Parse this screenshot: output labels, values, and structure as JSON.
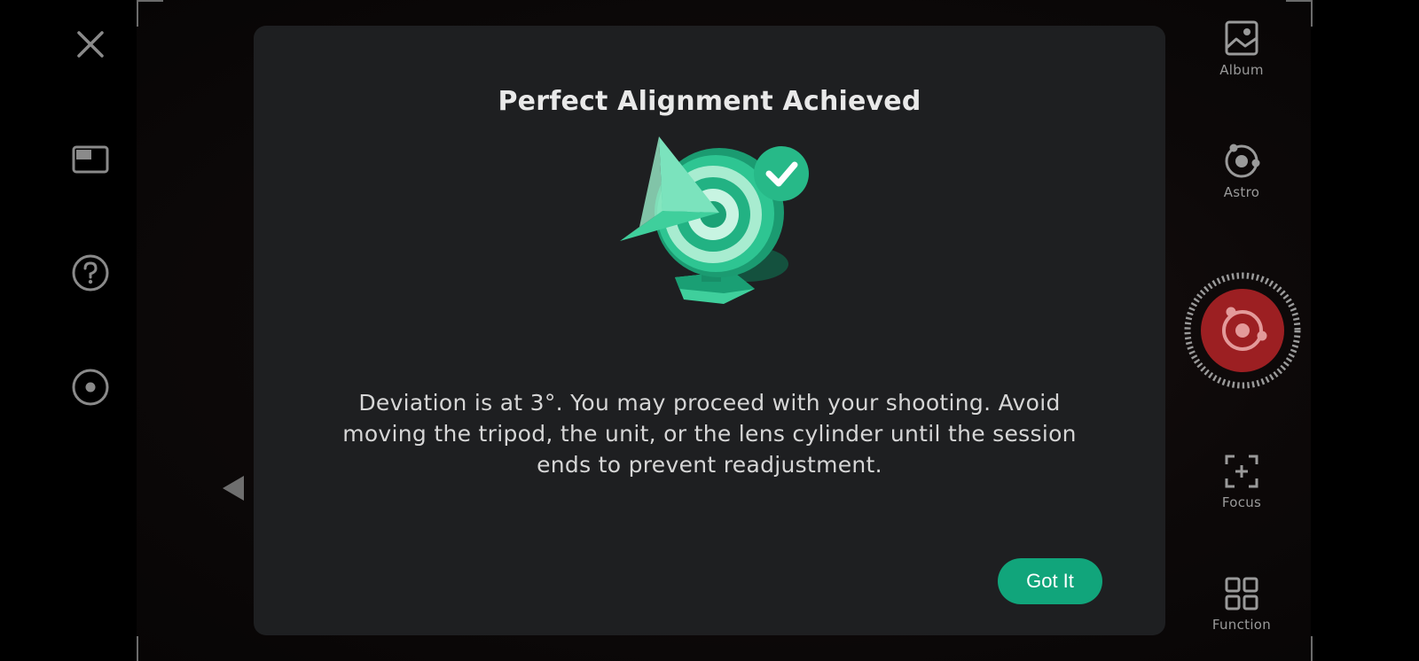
{
  "left_toolbar": {
    "icons": [
      "close-icon",
      "aspect-ratio-icon",
      "help-icon",
      "timer-icon"
    ]
  },
  "right_toolbar": {
    "album_label": "Album",
    "astro_label": "Astro",
    "focus_label": "Focus",
    "function_label": "Function"
  },
  "dialog": {
    "title": "Perfect Alignment Achieved",
    "message": "Deviation is at 3°. You may proceed with your shooting. Avoid moving the tripod, the unit, or the lens cylinder until the session ends to prevent readjustment.",
    "confirm_label": "Got It"
  },
  "colors": {
    "accent": "#11a57b",
    "shutter": "#9c1f22",
    "dialog_bg": "#1e1f21"
  }
}
